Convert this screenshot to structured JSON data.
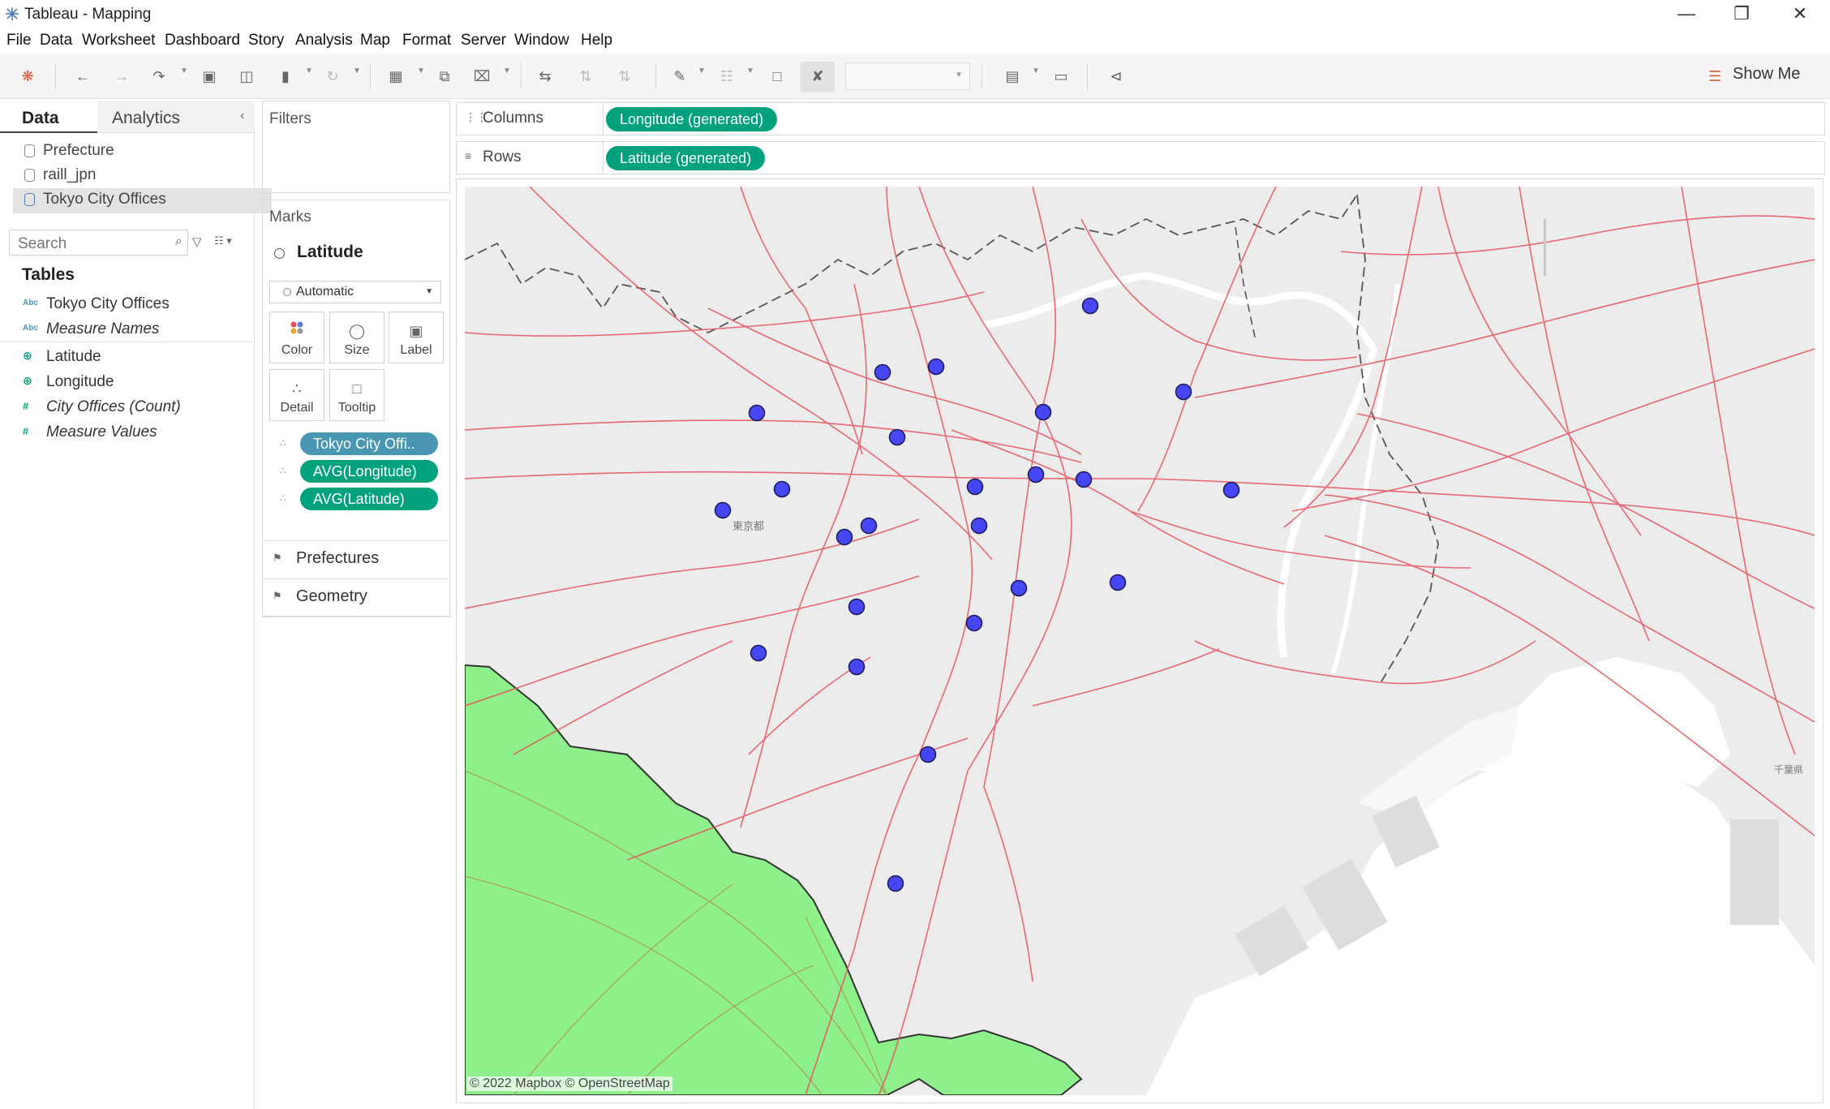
{
  "window": {
    "title": "Tableau - Mapping",
    "controls": [
      "minimize",
      "maximize",
      "close"
    ]
  },
  "menu": [
    "File",
    "Data",
    "Worksheet",
    "Dashboard",
    "Story",
    "Analysis",
    "Map",
    "Format",
    "Server",
    "Window",
    "Help"
  ],
  "toolbar": {
    "show_me": "Show Me",
    "icons": [
      "tableau-logo-icon",
      "undo-icon",
      "redo-icon",
      "replay-icon",
      "save-icon",
      "new-data-source-icon",
      "pause-updates-icon",
      "refresh-icon",
      "new-worksheet-icon",
      "duplicate-sheet-icon",
      "clear-sheet-icon",
      "swap-icon",
      "sort-ascending-icon",
      "sort-descending-icon",
      "highlight-icon",
      "group-icon",
      "labels-icon",
      "fix-axes-icon",
      "fit-icon",
      "presentation-icon",
      "share-icon"
    ]
  },
  "data_pane": {
    "tabs": [
      "Data",
      "Analytics"
    ],
    "data_sources": [
      "Prefecture",
      "raill_jpn",
      "Tokyo City Offices"
    ],
    "search_placeholder": "Search",
    "tables_heading": "Tables",
    "dimensions": [
      {
        "type": "Abc",
        "name": "Tokyo City Offices"
      },
      {
        "type": "Abc",
        "name": "Measure Names"
      }
    ],
    "measures": [
      {
        "type": "⊕",
        "name": "Latitude"
      },
      {
        "type": "⊕",
        "name": "Longitude"
      },
      {
        "type": "#",
        "name": "City Offices (Count)"
      },
      {
        "type": "#",
        "name": "Measure Values"
      }
    ]
  },
  "filters": {
    "title": "Filters"
  },
  "marks": {
    "title": "Marks",
    "layer": "Latitude",
    "mark_type": "Automatic",
    "buttons": [
      "Color",
      "Size",
      "Label",
      "Detail",
      "Tooltip"
    ],
    "pills": [
      "Tokyo City Offi..",
      "AVG(Longitude)",
      "AVG(Latitude)"
    ],
    "layers": [
      "Prefectures",
      "Geometry"
    ]
  },
  "shelves": {
    "columns_label": "Columns",
    "columns_pill": "Longitude (generated)",
    "rows_label": "Rows",
    "rows_pill": "Latitude (generated)"
  },
  "map": {
    "attribution": "© 2022 Mapbox © OpenStreetMap",
    "label_tokyo": "東京都",
    "label_chiba": "千葉県",
    "colors": {
      "rail": "#e8505b",
      "prefecture_fill": "#8ef08a",
      "point": "#4646f2",
      "land": "#ececec"
    },
    "point_count": 23
  }
}
